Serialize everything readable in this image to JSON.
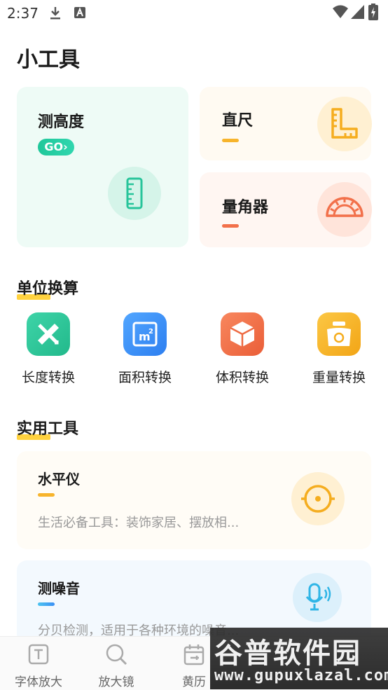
{
  "status_bar": {
    "time": "2:37"
  },
  "page": {
    "title": "小工具"
  },
  "cards": {
    "height": {
      "title": "测高度",
      "go": "GO›"
    },
    "ruler": {
      "title": "直尺"
    },
    "protractor": {
      "title": "量角器"
    }
  },
  "units": {
    "title": "单位换算",
    "items": [
      {
        "label": "长度转换",
        "icon": "ruler-pencil-icon",
        "color": "#2fc99c"
      },
      {
        "label": "面积转换",
        "icon": "area-m2-icon",
        "color": "#3a8ff5"
      },
      {
        "label": "体积转换",
        "icon": "cube-icon",
        "color": "#f2704a"
      },
      {
        "label": "重量转换",
        "icon": "scale-icon",
        "color": "#f7b42c"
      }
    ]
  },
  "tools": {
    "title": "实用工具",
    "level": {
      "title": "水平仪",
      "desc": "生活必备工具：装饰家居、摆放相..."
    },
    "noise": {
      "title": "测噪音",
      "desc": "分贝检测，适用于各种环境的噪音..."
    }
  },
  "tabbar": {
    "items": [
      {
        "label": "字体放大",
        "icon": "font-size-icon"
      },
      {
        "label": "放大镜",
        "icon": "magnifier-icon"
      },
      {
        "label": "黄历",
        "icon": "calendar-icon"
      }
    ]
  },
  "watermark": {
    "main": "谷普软件园",
    "url": "www.gupuxlazal.com"
  }
}
